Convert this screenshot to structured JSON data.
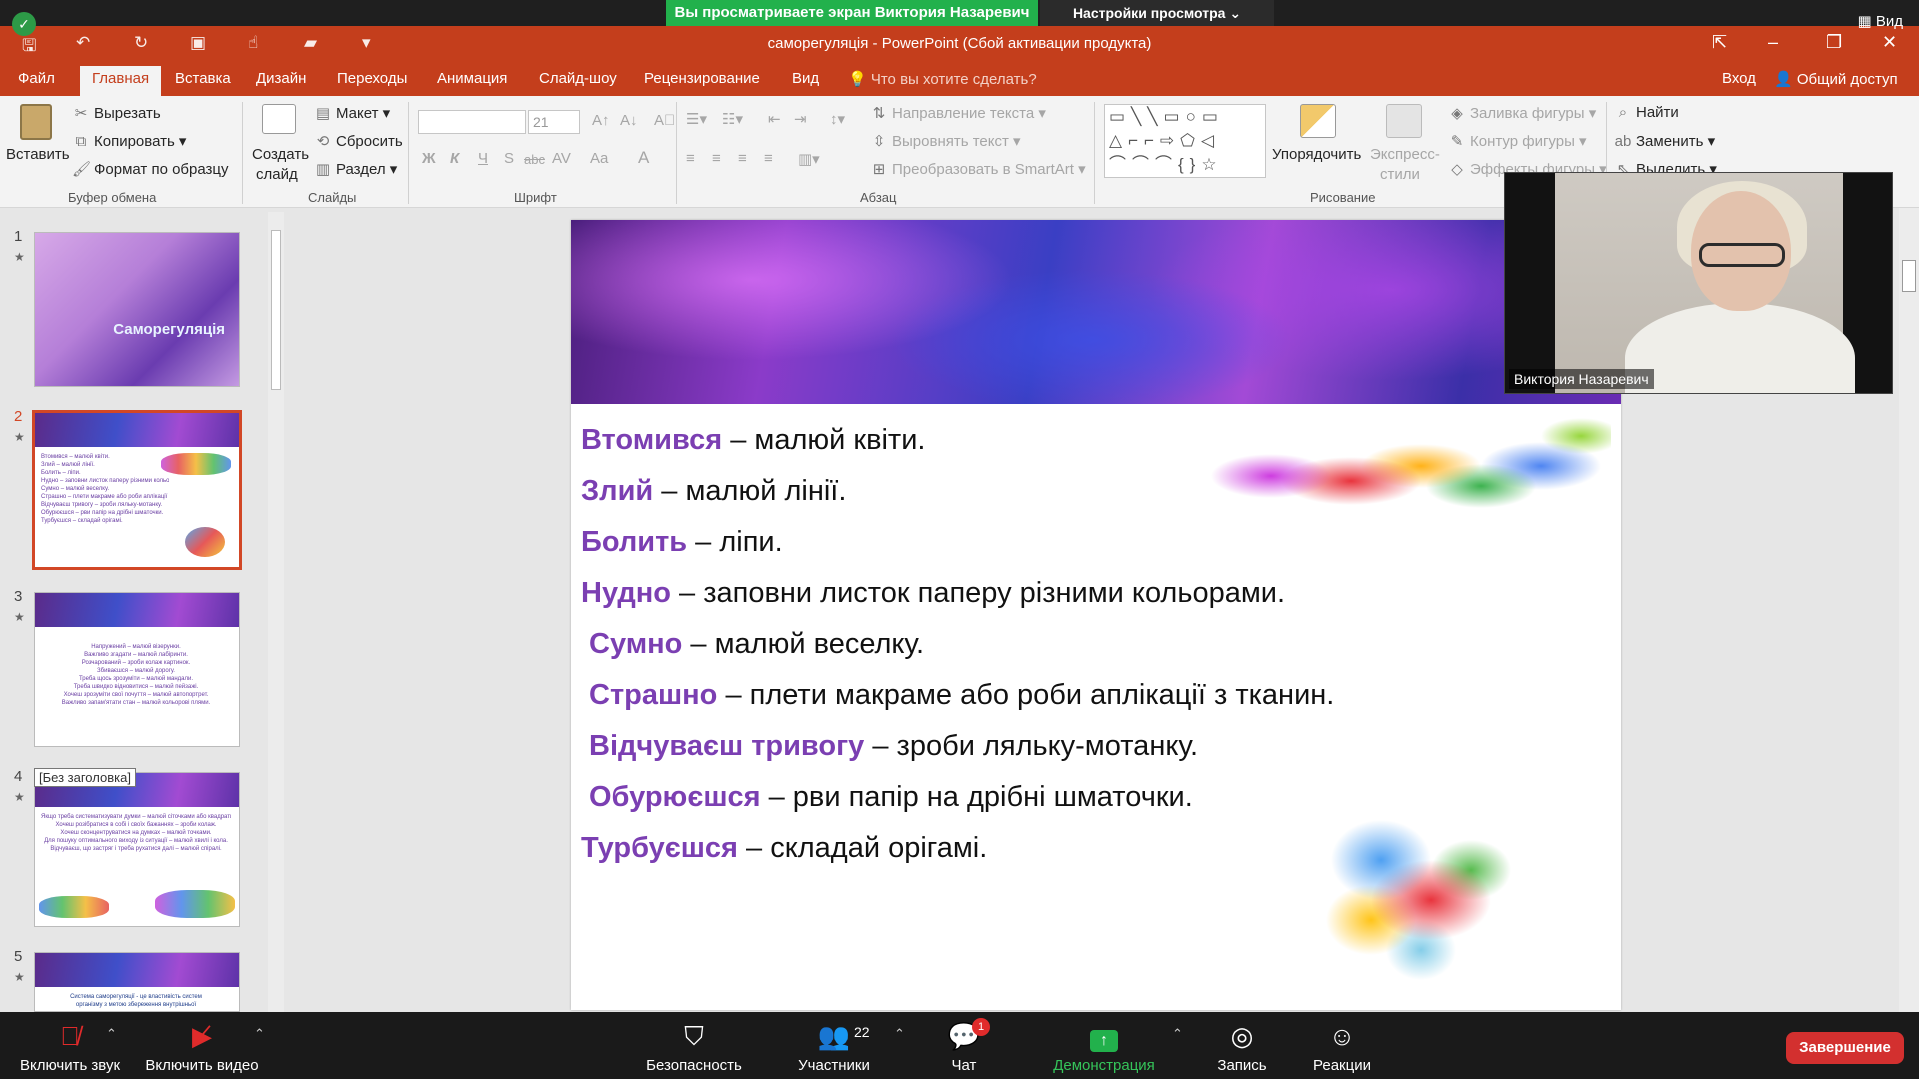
{
  "share_banner": {
    "viewing_text": "Вы просматриваете экран Виктория Назаревич",
    "view_settings": "Настройки просмотра",
    "view_label": "Вид"
  },
  "window": {
    "title": "саморегуляція - PowerPoint (Сбой активации продукта)"
  },
  "tabs": [
    "Файл",
    "Главная",
    "Вставка",
    "Дизайн",
    "Переходы",
    "Анимация",
    "Слайд-шоу",
    "Рецензирование",
    "Вид"
  ],
  "active_tab": "Главная",
  "tell_me": "Что вы хотите сделать?",
  "signin": "Вход",
  "share": "Общий доступ",
  "ribbon": {
    "clipboard": {
      "paste": "Вставить",
      "cut": "Вырезать",
      "copy": "Копировать",
      "format_painter": "Формат по образцу",
      "label": "Буфер обмена"
    },
    "slides": {
      "new_slide_1": "Создать",
      "new_slide_2": "слайд",
      "layout": "Макет",
      "reset": "Сбросить",
      "section": "Раздел",
      "label": "Слайды"
    },
    "font": {
      "size": "21",
      "bold": "Ж",
      "italic": "К",
      "underline": "Ч",
      "shadow": "S",
      "strike": "abc",
      "spacing": "AV",
      "case": "Aa",
      "color": "A",
      "label": "Шрифт"
    },
    "paragraph": {
      "text_direction": "Направление текста",
      "align_text": "Выровнять текст",
      "smartart": "Преобразовать в SmartArt",
      "label": "Абзац"
    },
    "drawing": {
      "arrange": "Упорядочить",
      "quick_styles_1": "Экспресс-",
      "quick_styles_2": "стили",
      "shape_fill": "Заливка фигуры",
      "shape_outline": "Контур фигуры",
      "shape_effects": "Эффекты фигуры",
      "label": "Рисование"
    },
    "editing": {
      "find": "Найти",
      "replace": "Заменить",
      "select": "Выделить"
    }
  },
  "thumbnails": {
    "nums": [
      "1",
      "2",
      "3",
      "4",
      "5"
    ],
    "slide1_title": "Саморегуляція",
    "slide2_lines": [
      "Втомився – малюй квіти.",
      "Злий – малюй лінії.",
      "Болить – ліпи.",
      "Нудно – заповни листок паперу різними кольорами",
      "Сумно – малюй веселку.",
      "Страшно – плети макраме або роби аплікації з тканин",
      "Відчуваєш тривогу – зроби ляльку-мотанку.",
      "Обурюєшся – рви папір на дрібні шматочки.",
      "Турбуєшся – складай орігамі."
    ],
    "slide3_lines": [
      "Напружений – малюй візерунки.",
      "Важливо згадати – малюй лабіринти.",
      "Розчарований – зроби колаж картинок.",
      "Збиваєшся – малюй дорогу.",
      "Треба щось зрозуміти – малюй мандали.",
      "Треба швидко відновитися – малюй пейзажі.",
      "Хочеш зрозуміти свої почуття – малюй автопортрет.",
      "Важливо запам'ятати стан – малюй кольорові плями."
    ],
    "slide4_lines": [
      "Якщо треба систематизувати думки – малюй сіточками або квадрати.",
      "Хочеш розібратися в собі і своїх бажаннях – зроби колаж.",
      "Хочеш сконцентруватися на думках – малюй точками.",
      "Для пошуку оптимального виходу із ситуації – малюй хвилі і кола.",
      "Відчуваєш, що застряг і треба рухатися далі – малюй спіралі."
    ],
    "slide5_lines": [
      "Система саморегуляції - це властивість систем",
      "організму з метою збереження внутрішньої"
    ],
    "tooltip": "[Без заголовка]"
  },
  "slide": {
    "lines": [
      {
        "key": "Втомився",
        "rest": " – малюй квіти."
      },
      {
        "key": "Злий",
        "rest": " – малюй лінії."
      },
      {
        "key": "Болить",
        "rest": " – ліпи."
      },
      {
        "key": "Нудно",
        "rest": " – заповни листок паперу різними кольорами."
      },
      {
        "key": "Сумно",
        "rest": " – малюй веселку."
      },
      {
        "key": "Страшно",
        "rest": " – плети макраме або роби аплікації з тканин."
      },
      {
        "key": "Відчуваєш тривогу",
        "rest": " – зроби ляльку-мотанку."
      },
      {
        "key": "Обурюєшся",
        "rest": " – рви папір на дрібні шматочки."
      },
      {
        "key": "Турбуєшся",
        "rest": " – складай орігамі."
      }
    ]
  },
  "video": {
    "name": "Виктория Назаревич"
  },
  "zoom_toolbar": {
    "mute": "Включить звук",
    "video": "Включить видео",
    "security": "Безопасность",
    "participants": "Участники",
    "participants_count": "22",
    "chat": "Чат",
    "chat_badge": "1",
    "share_screen": "Демонстрация экрана",
    "record": "Запись",
    "reactions": "Реакции",
    "end": "Завершение"
  },
  "colors": {
    "accent": "#c43e1c",
    "share_green": "#22b14c",
    "slide_key": "#7b3fb2",
    "end_red": "#d3302f"
  }
}
